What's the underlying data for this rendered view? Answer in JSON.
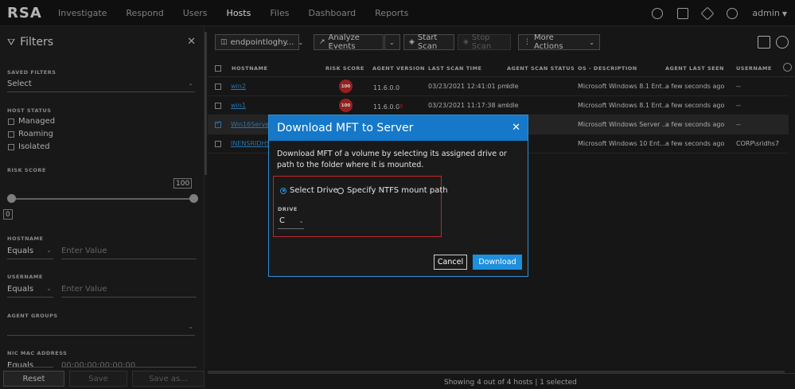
{
  "nav": {
    "logo": "RSA",
    "items": [
      "Investigate",
      "Respond",
      "Users",
      "Hosts",
      "Files",
      "Dashboard",
      "Reports"
    ],
    "active_index": 3,
    "user": "admin",
    "icons": [
      "timer-icon",
      "dashboard-icon",
      "tools-icon",
      "help-icon"
    ]
  },
  "filters": {
    "title": "Filters",
    "saved_filters_label": "SAVED FILTERS",
    "saved_filters_value": "Select",
    "host_status_label": "HOST STATUS",
    "host_status_options": [
      "Managed",
      "Roaming",
      "Isolated"
    ],
    "risk_score_label": "RISK SCORE",
    "risk_min": "0",
    "risk_max": "100",
    "hostname_label": "HOSTNAME",
    "hostname_operator": "Equals",
    "hostname_placeholder": "Enter Value",
    "username_label": "USERNAME",
    "username_operator": "Equals",
    "username_placeholder": "Enter Value",
    "agent_groups_label": "AGENT GROUPS",
    "nic_mac_label": "NIC MAC ADDRESS",
    "nic_mac_operator": "Equals",
    "nic_mac_placeholder": "00:00:00:00:00:00",
    "reset_label": "Reset",
    "save_label": "Save",
    "save_as_label": "Save as..."
  },
  "toolbar": {
    "server": "endpointloghy...",
    "analyze_events": "Analyze Events",
    "start_scan": "Start Scan",
    "stop_scan": "Stop Scan",
    "more_actions": "More Actions"
  },
  "table": {
    "headers": [
      "HOSTNAME",
      "RISK SCORE",
      "AGENT VERSION",
      "LAST SCAN TIME",
      "AGENT SCAN STATUS",
      "OS - DESCRIPTION",
      "AGENT LAST SEEN",
      "USERNAME"
    ],
    "rows": [
      {
        "hostname": "win2",
        "risk": "100",
        "version": "11.6.0.0",
        "scan_time": "03/23/2021 12:41:01 pm",
        "status": "Idle",
        "os": "Microsoft Windows 8.1 Ent...",
        "last_seen": "a few seconds ago",
        "username": "--",
        "selected": false
      },
      {
        "hostname": "win1",
        "risk": "100",
        "version": "11.6.0.0",
        "scan_time": "03/23/2021 11:17:38 am",
        "status": "Idle",
        "os": "Microsoft Windows 8.1 Ent...",
        "last_seen": "a few seconds ago",
        "username": "--",
        "selected": false
      },
      {
        "hostname": "Win16Server",
        "risk": "",
        "version": "",
        "scan_time": "",
        "status": "",
        "os": "Microsoft Windows Server ...",
        "last_seen": "a few seconds ago",
        "username": "--",
        "selected": true
      },
      {
        "hostname": "INENSRIDHS",
        "risk": "",
        "version": "",
        "scan_time": "",
        "status": "",
        "os": "Microsoft Windows 10 Ent...",
        "last_seen": "a few seconds ago",
        "username": "CORP\\sridhs7",
        "selected": false
      }
    ]
  },
  "footer": {
    "summary": "Showing 4 out of 4 hosts | 1 selected"
  },
  "dialog": {
    "title": "Download MFT to Server",
    "description": "Download MFT of a volume by selecting its assigned drive or path to the folder where it is mounted.",
    "option_drive": "Select Drive",
    "option_path": "Specify NTFS mount path",
    "drive_label": "DRIVE",
    "drive_value": "C",
    "cancel_label": "Cancel",
    "download_label": "Download"
  },
  "colors": {
    "accent": "#1578c9",
    "risk_badge": "#b72826",
    "highlight_box": "#c0282e"
  }
}
